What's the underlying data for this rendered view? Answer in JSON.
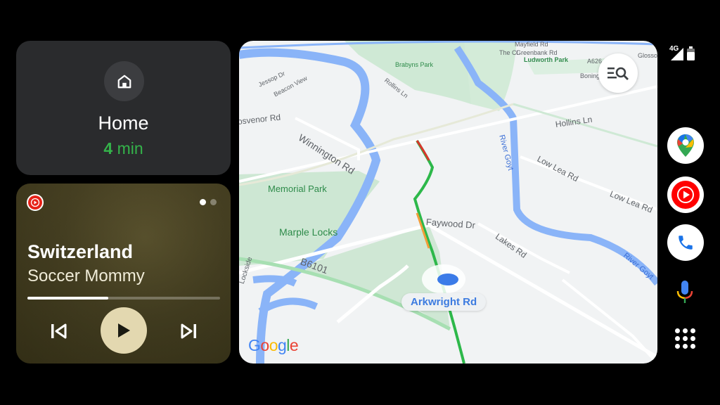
{
  "navigation_card": {
    "icon": "home-icon",
    "destination": "Home",
    "eta_number": "4",
    "eta_unit": "min",
    "eta_color": "#34b34a"
  },
  "media_card": {
    "source_icon": "youtube-music-icon",
    "song_title": "Switzerland",
    "artist": "Soccer Mommy",
    "progress_percent": 42,
    "page_indicator": {
      "count": 2,
      "active": 1
    },
    "controls": {
      "previous": "skip-previous-icon",
      "play": "play-icon",
      "next": "skip-next-icon"
    }
  },
  "map": {
    "current_street": "Arkwright Rd",
    "attribution": [
      "G",
      "o",
      "o",
      "g",
      "l",
      "e"
    ],
    "labels": {
      "brabyns_park": "Brabyns Park",
      "jessop_dr": "Jessop Dr",
      "beacon_view": "Beacon View",
      "rollins_ln": "Rollins Ln",
      "grosvenor_rd": "osvenor Rd",
      "winnington_rd": "Winnington Rd",
      "mayfield_rd": "Mayfield Rd",
      "the_cl": "The Cl",
      "greenbank_rd": "Greenbank Rd",
      "ludworth_park": "Ludworth Park",
      "a626": "A626",
      "glossop": "Glosso",
      "bonington": "Bonington",
      "hollins_ln": "Hollins Ln",
      "river_goyt_1": "River Goyt",
      "river_goyt_2": "River Goyt",
      "low_lea_rd_1": "Low Lea Rd",
      "low_lea_rd_2": "Low Lea Rd",
      "memorial_park": "Memorial Park",
      "marple_locks": "Marple Locks",
      "faywood_dr": "Faywood Dr",
      "lakes_rd": "Lakes Rd",
      "b6101": "B6101",
      "lockside": "Lockside"
    },
    "search_button_icon": "search-list-icon"
  },
  "status_bar": {
    "network": "4G",
    "signal": "signal-icon",
    "battery": "battery-icon"
  },
  "rail": {
    "apps": [
      {
        "name": "Google Maps",
        "icon": "google-maps-icon"
      },
      {
        "name": "YouTube Music",
        "icon": "youtube-music-icon"
      },
      {
        "name": "Phone",
        "icon": "phone-icon"
      }
    ],
    "assistant": "microphone-icon",
    "launcher": "app-launcher-icon"
  }
}
